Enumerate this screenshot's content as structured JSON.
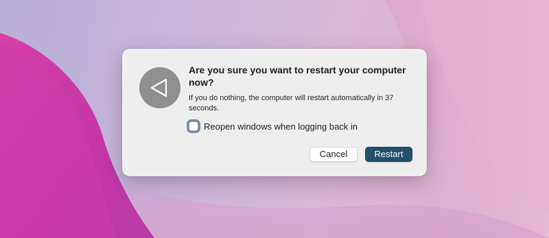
{
  "dialog": {
    "title": "Are you sure you want to restart your computer now?",
    "message": "If you do nothing, the computer will restart automatically in 37 seconds.",
    "checkbox": {
      "label": "Reopen windows when logging back in",
      "checked": false
    },
    "buttons": {
      "cancel_label": "Cancel",
      "restart_label": "Restart"
    },
    "icon": "restart-triangle-icon"
  },
  "colors": {
    "primary_button": "#24506b",
    "dialog_background": "#efeeef",
    "icon_circle": "#8f8f8f"
  }
}
